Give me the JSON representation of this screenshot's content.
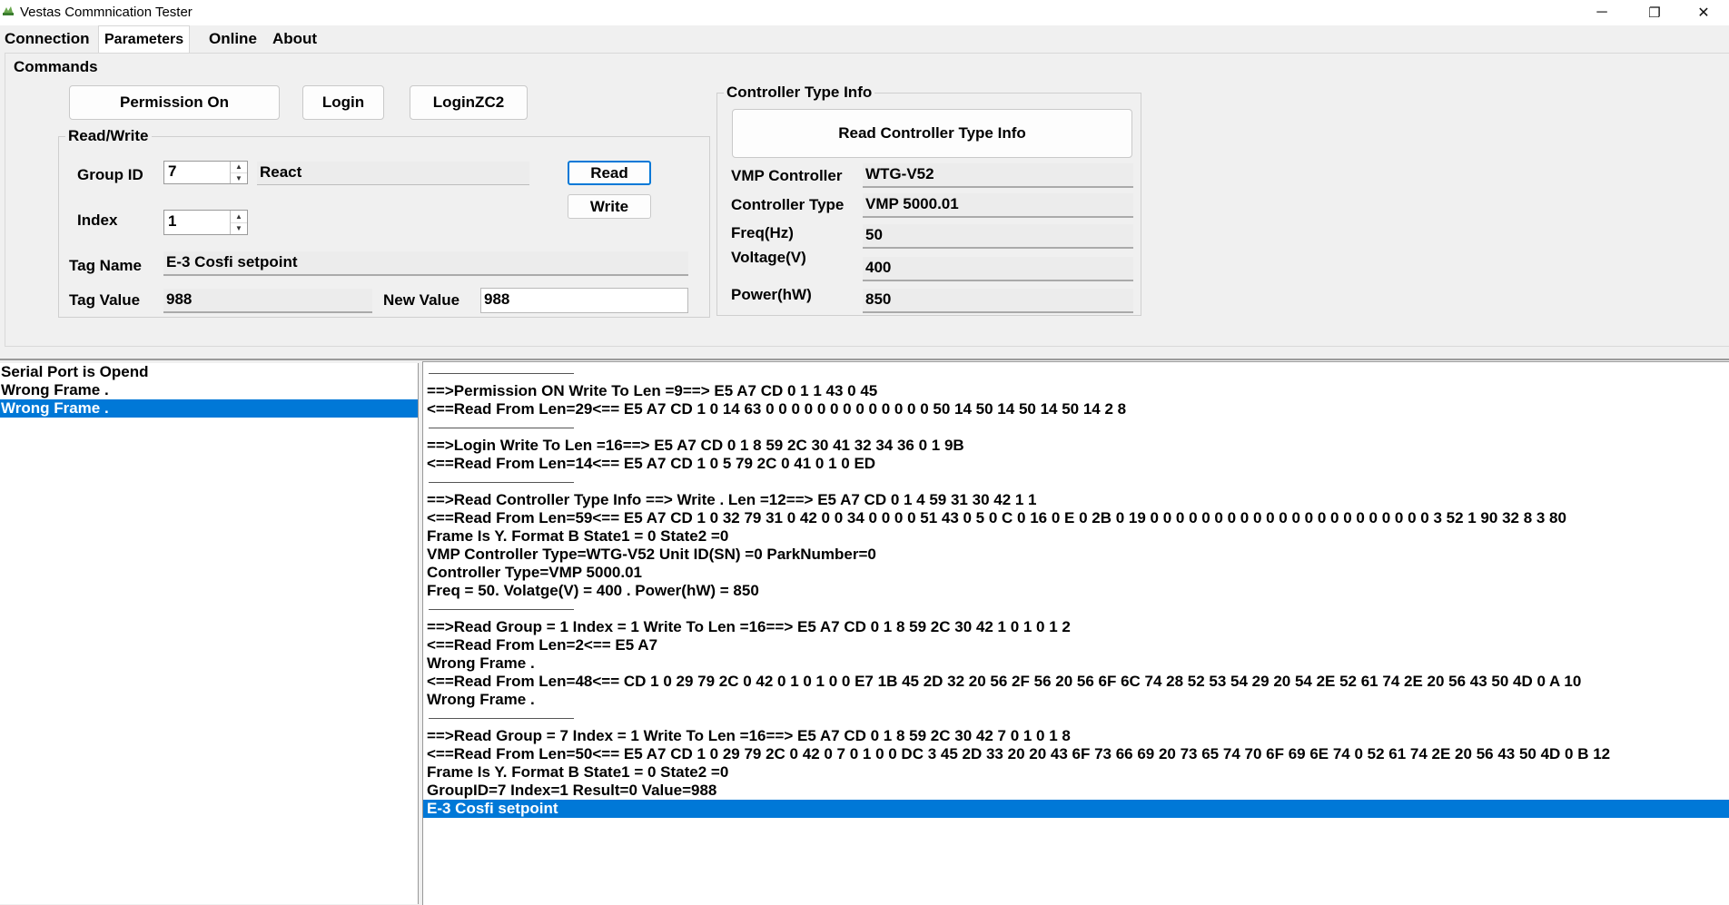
{
  "window": {
    "title": "Vestas Commnication Tester",
    "controls": {
      "minimize": "─",
      "restore": "❐",
      "close": "✕"
    }
  },
  "menu": {
    "tabs": [
      "Connection",
      "Parameters",
      "Online",
      "About"
    ],
    "active_tab": "Parameters"
  },
  "commands": {
    "title": "Commands",
    "buttons": {
      "permission_on": "Permission On",
      "login": "Login",
      "loginzc2": "LoginZC2"
    }
  },
  "read_write": {
    "title": "Read/Write",
    "group_id_label": "Group ID",
    "group_id_value": "7",
    "group_name": "React",
    "index_label": "Index",
    "index_value": "1",
    "read_button": "Read",
    "write_button": "Write",
    "tag_name_label": "Tag Name",
    "tag_name_value": "E-3  Cosfi setpoint",
    "tag_value_label": "Tag Value",
    "tag_value": "988",
    "new_value_label": "New  Value",
    "new_value": "988"
  },
  "controller_info": {
    "title": "Controller Type Info",
    "read_button": "Read Controller Type Info",
    "fields": [
      {
        "label": "VMP Controller",
        "value": "WTG-V52"
      },
      {
        "label": "Controller Type",
        "value": "VMP 5000.01"
      },
      {
        "label": "Freq(Hz)",
        "value": "50"
      },
      {
        "label": "Voltage(V)",
        "value": "400"
      },
      {
        "label": "Power(hW)",
        "value": "850"
      }
    ]
  },
  "status_list": [
    "Serial Port is Opend",
    "Wrong Frame .",
    "Wrong Frame ."
  ],
  "status_selected_index": 2,
  "log_lines": [
    "---------------------------",
    "==>Permission ON Write To Len =9==> E5 A7 CD 0 1 1 43 0 45",
    "<==Read From Len=29<== E5 A7 CD 1 0 14 63 0 0 0 0 0 0 0 0 0 0 0 0 0 50 14 50 14 50 14 50 14 2 8",
    "---------------------------",
    "==>Login Write To Len =16==> E5 A7 CD 0 1 8 59 2C 30 41 32 34 36 0 1 9B",
    "<==Read From Len=14<== E5 A7 CD 1 0 5 79 2C 0 41 0 1 0 ED",
    "---------------------------",
    "==>Read Controller Type Info ==> Write . Len =12==> E5 A7 CD 0 1 4 59 31 30 42 1 1",
    "<==Read From Len=59<== E5 A7 CD 1 0 32 79 31 0 42 0 0 34 0 0 0 0 51 43 0 5 0 C 0 16 0 E 0 2B 0 19 0 0 0 0 0 0 0 0 0 0 0 0 0 0 0 0 0 0 0 0 0 0 3 52 1 90 32 8 3 80",
    "Frame Is Y. Format B State1 = 0 State2 =0",
    "VMP Controller Type=WTG-V52 Unit ID(SN) =0 ParkNumber=0",
    "Controller Type=VMP 5000.01",
    "Freq = 50. Volatge(V) = 400 . Power(hW) = 850",
    "---------------------------",
    "==>Read Group = 1 Index = 1 Write To Len =16==> E5 A7 CD 0 1 8 59 2C 30 42 1 0 1 0 1 2",
    "<==Read From Len=2<== E5 A7",
    "Wrong Frame .",
    "<==Read From Len=48<== CD 1 0 29 79 2C 0 42 0 1 0 1 0 0 E7 1B 45 2D 32 20 56 2F 56 20 56 6F 6C 74 28 52 53 54 29 20 54 2E 52 61 74 2E 20 56 43 50 4D 0 A 10",
    "Wrong Frame .",
    "---------------------------",
    "==>Read Group = 7 Index = 1 Write To Len =16==> E5 A7 CD 0 1 8 59 2C 30 42 7 0 1 0 1 8",
    "<==Read From Len=50<== E5 A7 CD 1 0 29 79 2C 0 42 0 7 0 1 0 0 DC 3 45 2D 33 20 20 43 6F 73 66 69 20 73 65 74 70 6F 69 6E 74 0 52 61 74 2E 20 56 43 50 4D 0 B 12",
    "Frame Is Y. Format B State1 = 0 State2 =0",
    "GroupID=7 Index=1 Result=0 Value=988",
    "E-3  Cosfi setpoint"
  ],
  "log_selected_index": 24,
  "colors": {
    "selection": "#0078d7",
    "background": "#f0f0f0"
  }
}
